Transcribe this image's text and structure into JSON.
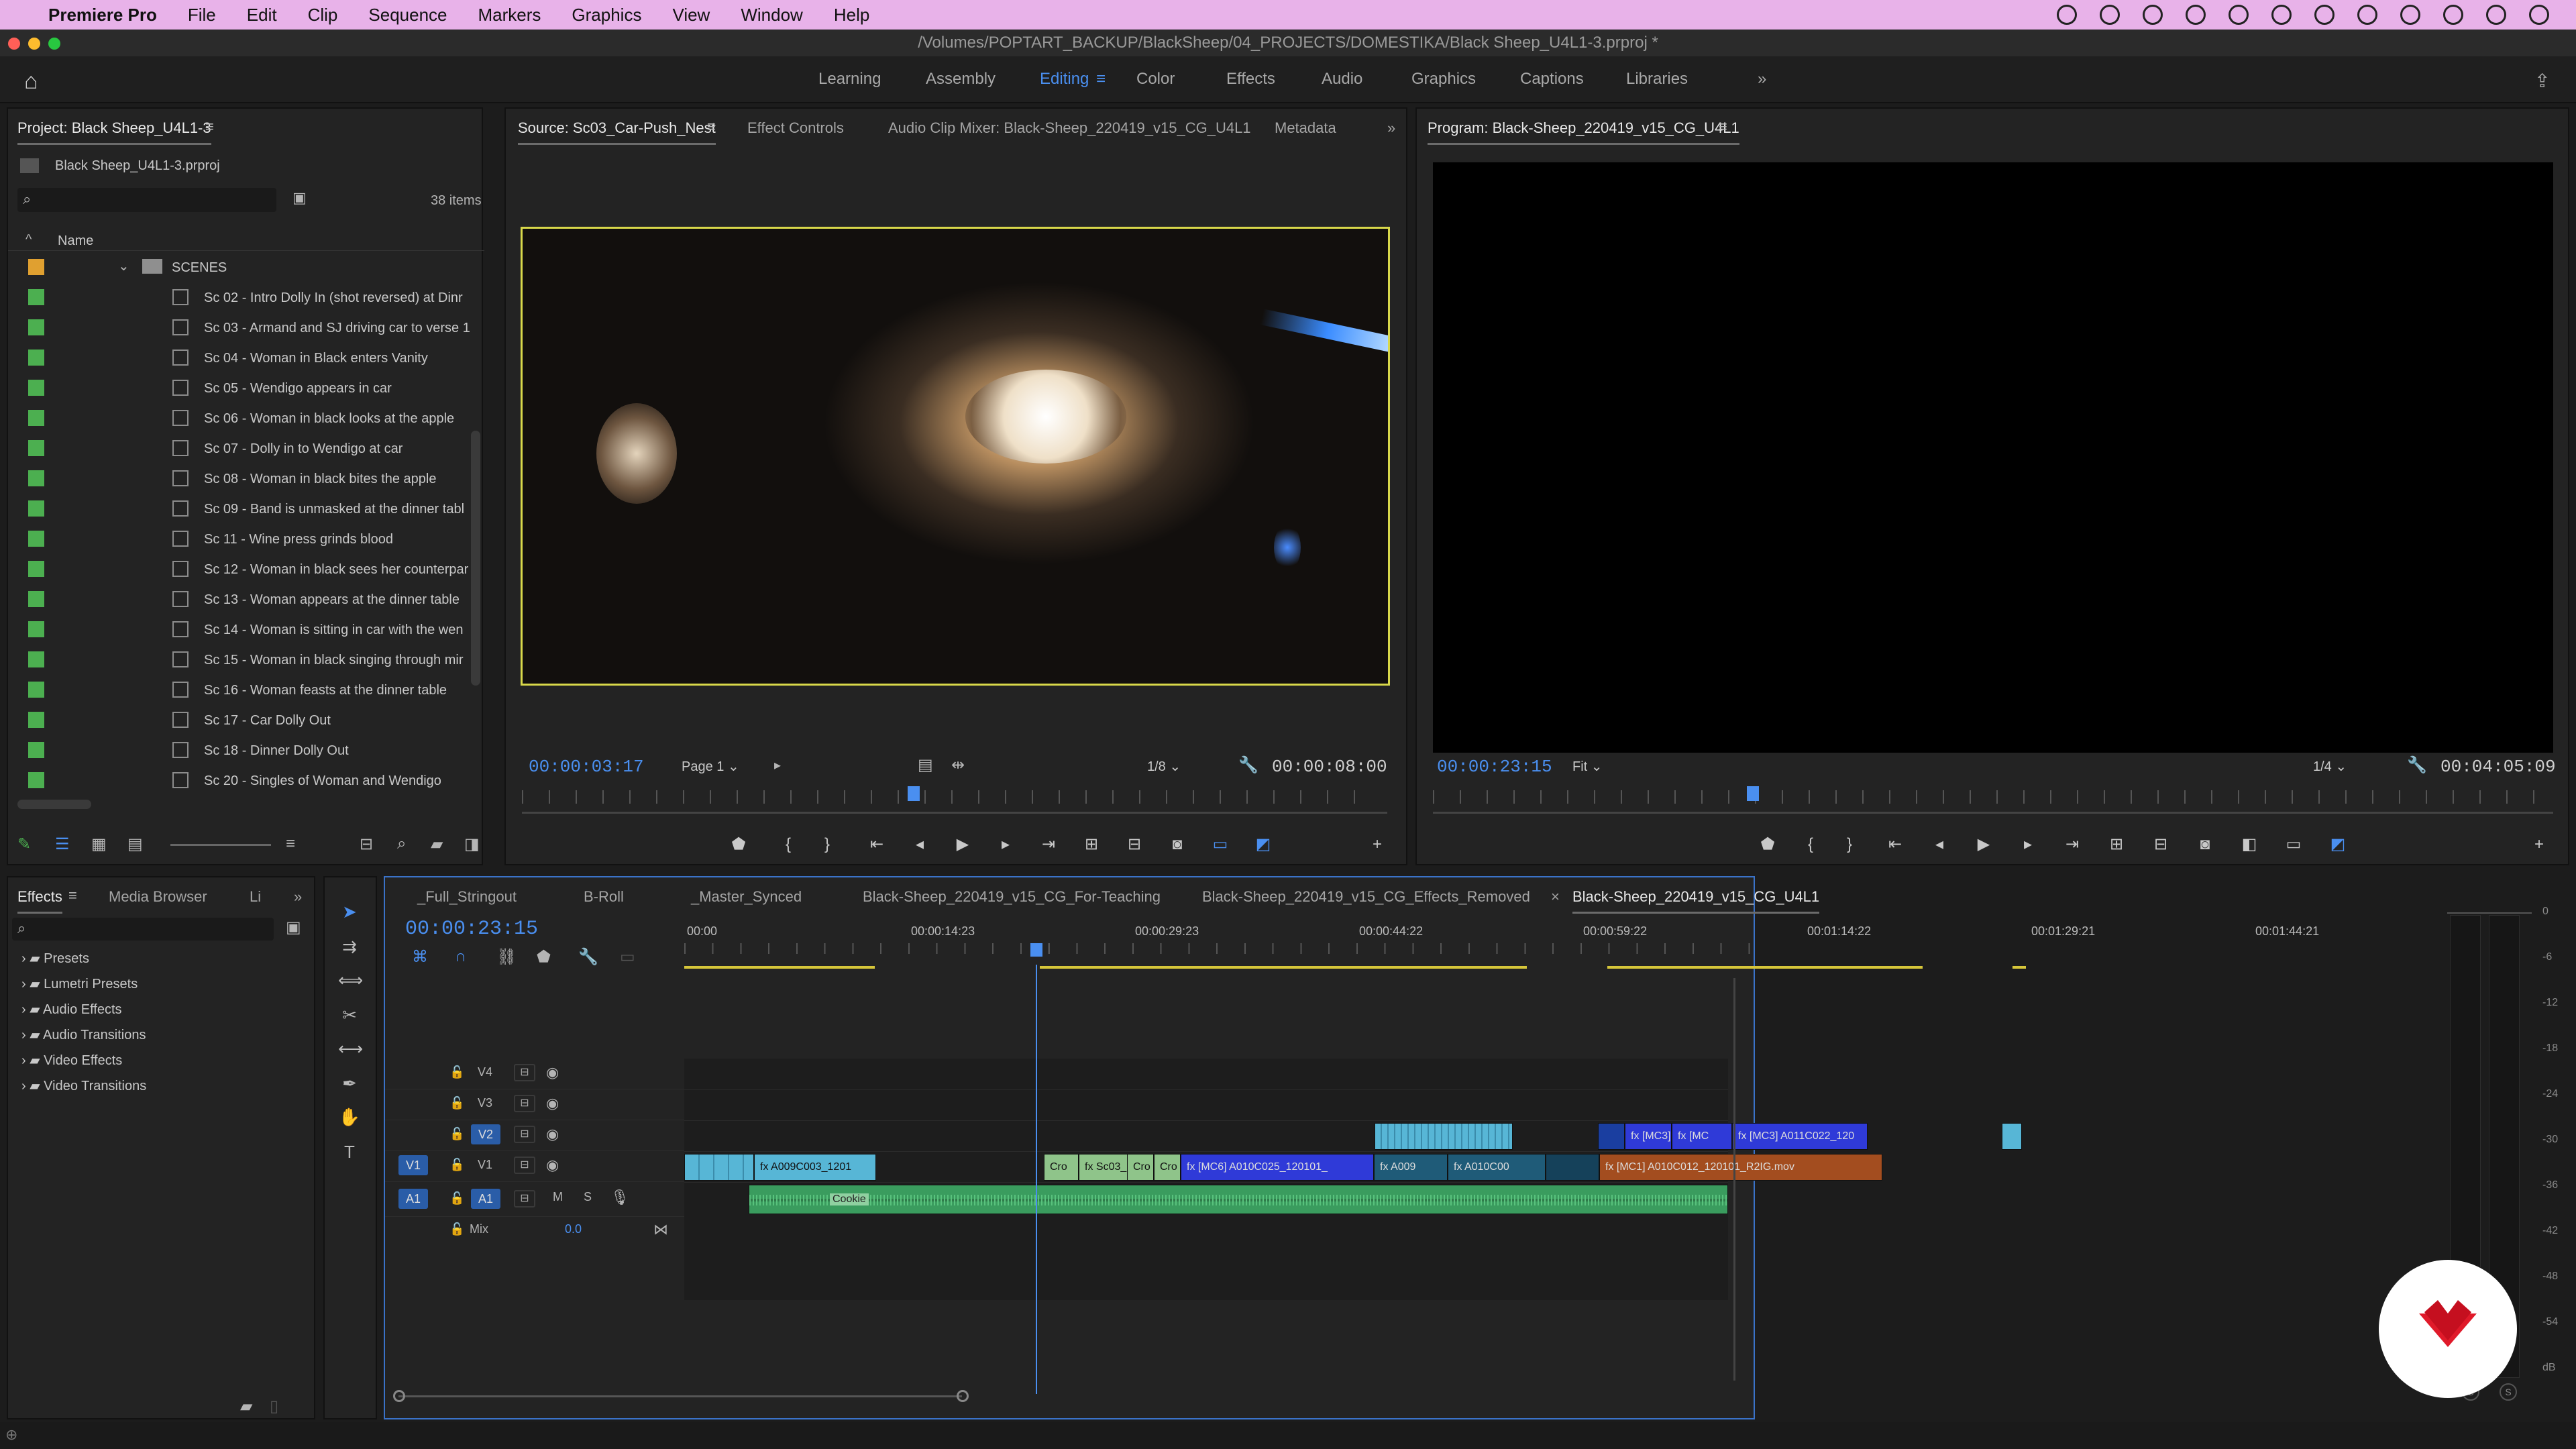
{
  "menubar": {
    "app": "Premiere Pro",
    "items": [
      "File",
      "Edit",
      "Clip",
      "Sequence",
      "Markers",
      "Graphics",
      "View",
      "Window",
      "Help"
    ]
  },
  "window_title": "/Volumes/POPTART_BACKUP/BlackSheep/04_PROJECTS/DOMESTIKA/Black Sheep_U4L1-3.prproj *",
  "workspaces": [
    "Learning",
    "Assembly",
    "Editing",
    "Color",
    "Effects",
    "Audio",
    "Graphics",
    "Captions",
    "Libraries"
  ],
  "active_workspace": "Editing",
  "project": {
    "tab": "Project: Black Sheep_U4L1-3",
    "file": "Black Sheep_U4L1-3.prproj",
    "count": "38 items",
    "col_name": "Name",
    "folder": "SCENES",
    "items": [
      "Sc 02 - Intro Dolly In (shot reversed) at Dinr",
      "Sc 03 - Armand and SJ driving car to verse 1",
      "Sc 04 - Woman in Black enters Vanity",
      "Sc 05 - Wendigo appears in car",
      "Sc 06 - Woman in black looks at the apple",
      "Sc 07 - Dolly in to Wendigo at car",
      "Sc 08 - Woman in black bites the apple",
      "Sc 09 - Band is unmasked at the dinner tabl",
      "Sc 11 - Wine press grinds blood",
      "Sc 12 - Woman in black sees her counterpar",
      "Sc 13 - Woman appears at the dinner table",
      "Sc 14 - Woman is sitting in car with the wen",
      "Sc 15 - Woman in black singing through mir",
      "Sc 16 - Woman feasts at the dinner table",
      "Sc 17 - Car Dolly Out",
      "Sc 18 - Dinner Dolly Out",
      "Sc 20 - Singles of Woman and Wendigo"
    ]
  },
  "source": {
    "tabs": [
      "Source: Sc03_Car-Push_Nest",
      "Effect Controls",
      "Audio Clip Mixer: Black-Sheep_220419_v15_CG_U4L1",
      "Metadata"
    ],
    "timecode": "00:00:03:17",
    "page": "Page 1",
    "zoom": "1/8",
    "duration": "00:00:08:00",
    "playhead_fraction": 0.46
  },
  "program": {
    "tab": "Program: Black-Sheep_220419_v15_CG_U4L1",
    "timecode": "00:00:23:15",
    "fit": "Fit",
    "zoom": "1/4",
    "duration": "00:04:05:09",
    "playhead_fraction": 0.28
  },
  "effects": {
    "tabs": [
      "Effects",
      "Media Browser",
      "Li"
    ],
    "items": [
      "Presets",
      "Lumetri Presets",
      "Audio Effects",
      "Audio Transitions",
      "Video Effects",
      "Video Transitions"
    ]
  },
  "timeline": {
    "tabs": [
      "_Full_Stringout",
      "B-Roll",
      "_Master_Synced",
      "Black-Sheep_220419_v15_CG_For-Teaching",
      "Black-Sheep_220419_v15_CG_Effects_Removed",
      "Black-Sheep_220419_v15_CG_U4L1"
    ],
    "timecode": "00:00:23:15",
    "ruler": [
      "00:00",
      "00:00:14:23",
      "00:00:29:23",
      "00:00:44:22",
      "00:00:59:22",
      "00:01:14:22",
      "00:01:29:21",
      "00:01:44:21"
    ],
    "tracks": [
      "V4",
      "V3",
      "V2",
      "V1",
      "A1"
    ],
    "mix_label": "Mix",
    "mix_value": "0.0",
    "clips": [
      "A009C003_1201",
      "Cro",
      "Sc03_",
      "Cro",
      "Cro",
      "[MC6] A010C025_120101_",
      "A009",
      "A010C00",
      "[MC3]",
      "[MC",
      "[MC3] A011C022_120",
      "[MC1] A010C012_120101_R2IG.mov",
      "Cookie"
    ]
  },
  "meter_scale": [
    "0",
    "-6",
    "-12",
    "-18",
    "-24",
    "-30",
    "-36",
    "-42",
    "-48",
    "-54",
    "dB"
  ],
  "meter_solo": [
    "S",
    "S"
  ]
}
